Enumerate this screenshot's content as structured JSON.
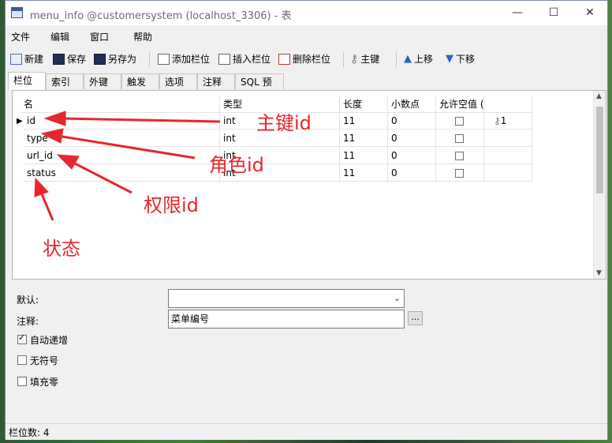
{
  "window": {
    "title": "menu_info @customersystem (localhost_3306) - 表",
    "minimize_glyph": "—",
    "maximize_glyph": "☐",
    "close_glyph": "✕"
  },
  "menu": [
    "文件",
    "编辑",
    "窗口",
    "帮助"
  ],
  "toolbar": {
    "new": "新建",
    "save": "保存",
    "save_as": "另存为",
    "add_col": "添加栏位",
    "insert_col": "插入栏位",
    "delete_col": "删除栏位",
    "primary_key": "主键",
    "move_up": "上移",
    "move_down": "下移"
  },
  "tabs": [
    "栏位",
    "索引",
    "外键",
    "触发器",
    "选项",
    "注释",
    "SQL 预览"
  ],
  "grid": {
    "headers": [
      "名",
      "类型",
      "长度",
      "小数点",
      "允许空值 ("
    ],
    "rows": [
      {
        "name": "id",
        "type": "int",
        "length": "11",
        "decimals": "0",
        "key": "1"
      },
      {
        "name": "type",
        "type": "int",
        "length": "11",
        "decimals": "0",
        "key": ""
      },
      {
        "name": "url_id",
        "type": "int",
        "length": "11",
        "decimals": "0",
        "key": ""
      },
      {
        "name": "status",
        "type": "int",
        "length": "11",
        "decimals": "0",
        "key": ""
      }
    ]
  },
  "annotations": {
    "primary_key_id": "主键id",
    "role_id": "角色id",
    "permission_id": "权限id",
    "status": "状态"
  },
  "properties": {
    "default_label": "默认:",
    "default_value": "",
    "comment_label": "注释:",
    "comment_value": "菜单编号",
    "comment_button": "...",
    "auto_increment_label": "自动递增",
    "auto_increment_checked": true,
    "unsigned_label": "无符号",
    "unsigned_checked": false,
    "zerofill_label": "填充零",
    "zerofill_checked": false
  },
  "status": {
    "text": "栏位数: 4"
  },
  "colors": {
    "annotation_red": "#e8262c"
  }
}
